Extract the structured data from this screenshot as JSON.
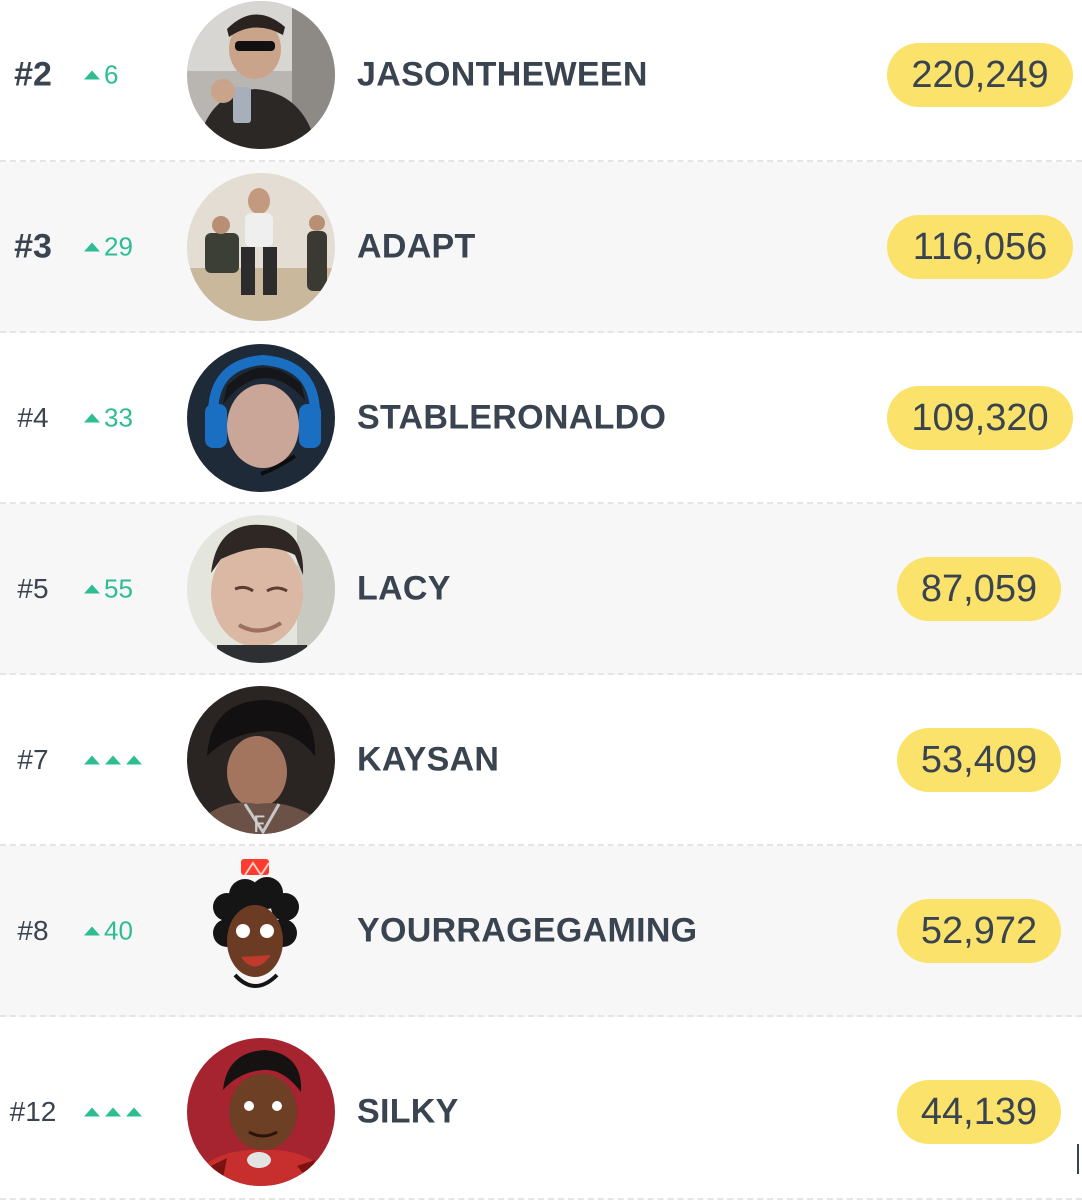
{
  "leaderboard": {
    "rows": [
      {
        "rank": "#2",
        "change": "6",
        "change_type": "up",
        "name": "JASONTHEWEEN",
        "score": "220,249",
        "avatar_icon": "selfie-photo-avatar"
      },
      {
        "rank": "#3",
        "change": "29",
        "change_type": "up",
        "name": "ADAPT",
        "score": "116,056",
        "avatar_icon": "group-photo-avatar"
      },
      {
        "rank": "#4",
        "change": "33",
        "change_type": "up",
        "name": "STABLERONALDO",
        "score": "109,320",
        "avatar_icon": "headset-photo-avatar"
      },
      {
        "rank": "#5",
        "change": "55",
        "change_type": "up",
        "name": "LACY",
        "score": "87,059",
        "avatar_icon": "face-photo-avatar"
      },
      {
        "rank": "#7",
        "change": "",
        "change_type": "new",
        "name": "KAYSAN",
        "score": "53,409",
        "avatar_icon": "profile-photo-avatar"
      },
      {
        "rank": "#8",
        "change": "40",
        "change_type": "up",
        "name": "YOURRAGEGAMING",
        "score": "52,972",
        "avatar_icon": "cartoon-avatar"
      },
      {
        "rank": "#12",
        "change": "",
        "change_type": "new",
        "name": "SILKY",
        "score": "44,139",
        "avatar_icon": "cartoon-avatar"
      }
    ]
  },
  "colors": {
    "score_pill": "#fbe26a",
    "up_arrow": "#2ebd93",
    "text": "#3a4450",
    "alt_row": "#f7f7f8"
  }
}
